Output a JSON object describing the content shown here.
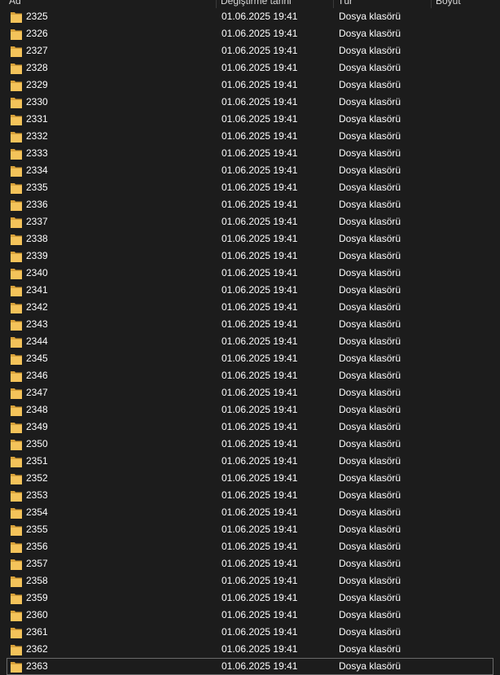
{
  "columns": {
    "name": "Ad",
    "date": "Değiştirme tarihi",
    "type": "Tür",
    "size": "Boyut"
  },
  "colors": {
    "background": "#1c1c1c",
    "folder_front": "#f4c35a",
    "folder_back": "#d9a23a"
  },
  "icons": {
    "folder": "folder-icon"
  },
  "rows": [
    {
      "name": "2325",
      "date": "01.06.2025 19:41",
      "type": "Dosya klasörü"
    },
    {
      "name": "2326",
      "date": "01.06.2025 19:41",
      "type": "Dosya klasörü"
    },
    {
      "name": "2327",
      "date": "01.06.2025 19:41",
      "type": "Dosya klasörü"
    },
    {
      "name": "2328",
      "date": "01.06.2025 19:41",
      "type": "Dosya klasörü"
    },
    {
      "name": "2329",
      "date": "01.06.2025 19:41",
      "type": "Dosya klasörü"
    },
    {
      "name": "2330",
      "date": "01.06.2025 19:41",
      "type": "Dosya klasörü"
    },
    {
      "name": "2331",
      "date": "01.06.2025 19:41",
      "type": "Dosya klasörü"
    },
    {
      "name": "2332",
      "date": "01.06.2025 19:41",
      "type": "Dosya klasörü"
    },
    {
      "name": "2333",
      "date": "01.06.2025 19:41",
      "type": "Dosya klasörü"
    },
    {
      "name": "2334",
      "date": "01.06.2025 19:41",
      "type": "Dosya klasörü"
    },
    {
      "name": "2335",
      "date": "01.06.2025 19:41",
      "type": "Dosya klasörü"
    },
    {
      "name": "2336",
      "date": "01.06.2025 19:41",
      "type": "Dosya klasörü"
    },
    {
      "name": "2337",
      "date": "01.06.2025 19:41",
      "type": "Dosya klasörü"
    },
    {
      "name": "2338",
      "date": "01.06.2025 19:41",
      "type": "Dosya klasörü"
    },
    {
      "name": "2339",
      "date": "01.06.2025 19:41",
      "type": "Dosya klasörü"
    },
    {
      "name": "2340",
      "date": "01.06.2025 19:41",
      "type": "Dosya klasörü"
    },
    {
      "name": "2341",
      "date": "01.06.2025 19:41",
      "type": "Dosya klasörü"
    },
    {
      "name": "2342",
      "date": "01.06.2025 19:41",
      "type": "Dosya klasörü"
    },
    {
      "name": "2343",
      "date": "01.06.2025 19:41",
      "type": "Dosya klasörü"
    },
    {
      "name": "2344",
      "date": "01.06.2025 19:41",
      "type": "Dosya klasörü"
    },
    {
      "name": "2345",
      "date": "01.06.2025 19:41",
      "type": "Dosya klasörü"
    },
    {
      "name": "2346",
      "date": "01.06.2025 19:41",
      "type": "Dosya klasörü"
    },
    {
      "name": "2347",
      "date": "01.06.2025 19:41",
      "type": "Dosya klasörü"
    },
    {
      "name": "2348",
      "date": "01.06.2025 19:41",
      "type": "Dosya klasörü"
    },
    {
      "name": "2349",
      "date": "01.06.2025 19:41",
      "type": "Dosya klasörü"
    },
    {
      "name": "2350",
      "date": "01.06.2025 19:41",
      "type": "Dosya klasörü"
    },
    {
      "name": "2351",
      "date": "01.06.2025 19:41",
      "type": "Dosya klasörü"
    },
    {
      "name": "2352",
      "date": "01.06.2025 19:41",
      "type": "Dosya klasörü"
    },
    {
      "name": "2353",
      "date": "01.06.2025 19:41",
      "type": "Dosya klasörü"
    },
    {
      "name": "2354",
      "date": "01.06.2025 19:41",
      "type": "Dosya klasörü"
    },
    {
      "name": "2355",
      "date": "01.06.2025 19:41",
      "type": "Dosya klasörü"
    },
    {
      "name": "2356",
      "date": "01.06.2025 19:41",
      "type": "Dosya klasörü"
    },
    {
      "name": "2357",
      "date": "01.06.2025 19:41",
      "type": "Dosya klasörü"
    },
    {
      "name": "2358",
      "date": "01.06.2025 19:41",
      "type": "Dosya klasörü"
    },
    {
      "name": "2359",
      "date": "01.06.2025 19:41",
      "type": "Dosya klasörü"
    },
    {
      "name": "2360",
      "date": "01.06.2025 19:41",
      "type": "Dosya klasörü"
    },
    {
      "name": "2361",
      "date": "01.06.2025 19:41",
      "type": "Dosya klasörü"
    },
    {
      "name": "2362",
      "date": "01.06.2025 19:41",
      "type": "Dosya klasörü"
    },
    {
      "name": "2363",
      "date": "01.06.2025 19:41",
      "type": "Dosya klasörü",
      "selected": true
    }
  ]
}
